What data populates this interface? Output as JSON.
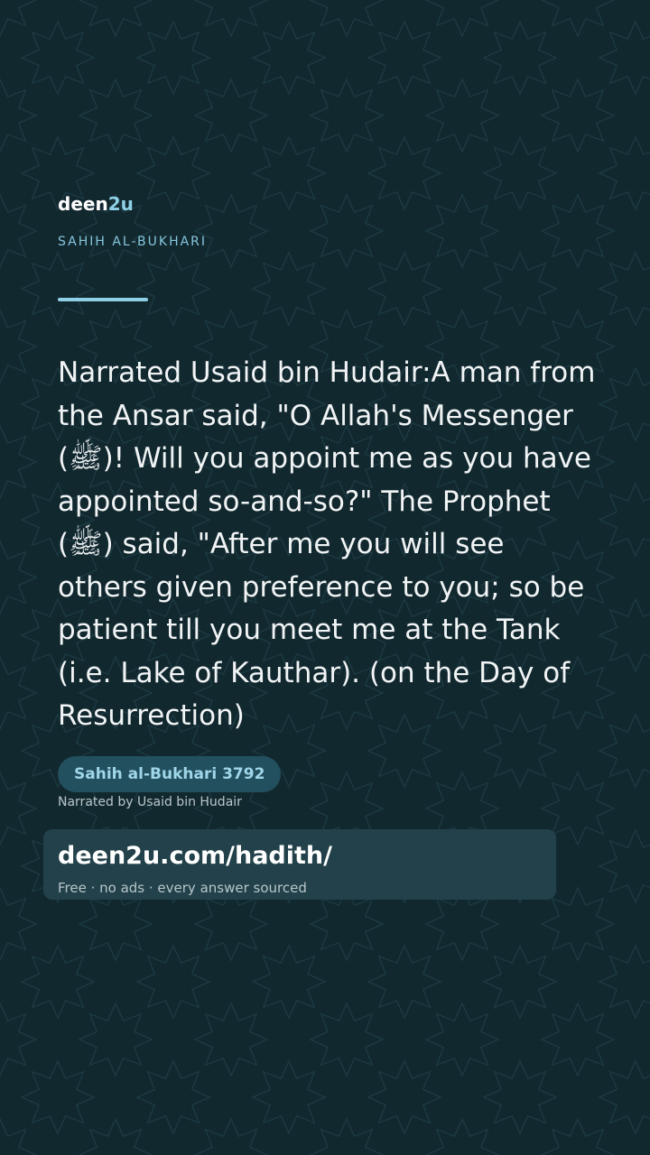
{
  "brand": {
    "name_main": "deen",
    "name_accent": "2u"
  },
  "collection_label": "SAHIH AL-BUKHARI",
  "hadith_text": "Narrated Usaid bin Hudair:A man from the Ansar said, \"O Allah's Messenger (ﷺ)! Will you appoint me as you have appointed so-and-so?\" The Prophet (ﷺ) said, \"After me you will see others given preference to you; so be patient till you meet me at the Tank (i.e. Lake of Kauthar). (on the Day of Resurrection)",
  "reference": "Sahih al-Bukhari 3792",
  "narrator_line": "Narrated by Usaid bin Hudair",
  "cta": {
    "url": "deen2u.com/hadith/",
    "tagline": "Free · no ads · every answer sourced"
  },
  "colors": {
    "background": "#12282f",
    "accent": "#8fd0e6",
    "badge_background": "#23505e",
    "cta_background": "#22414a"
  },
  "decoration": {
    "pattern_icon": "eight-point-star-icon"
  }
}
